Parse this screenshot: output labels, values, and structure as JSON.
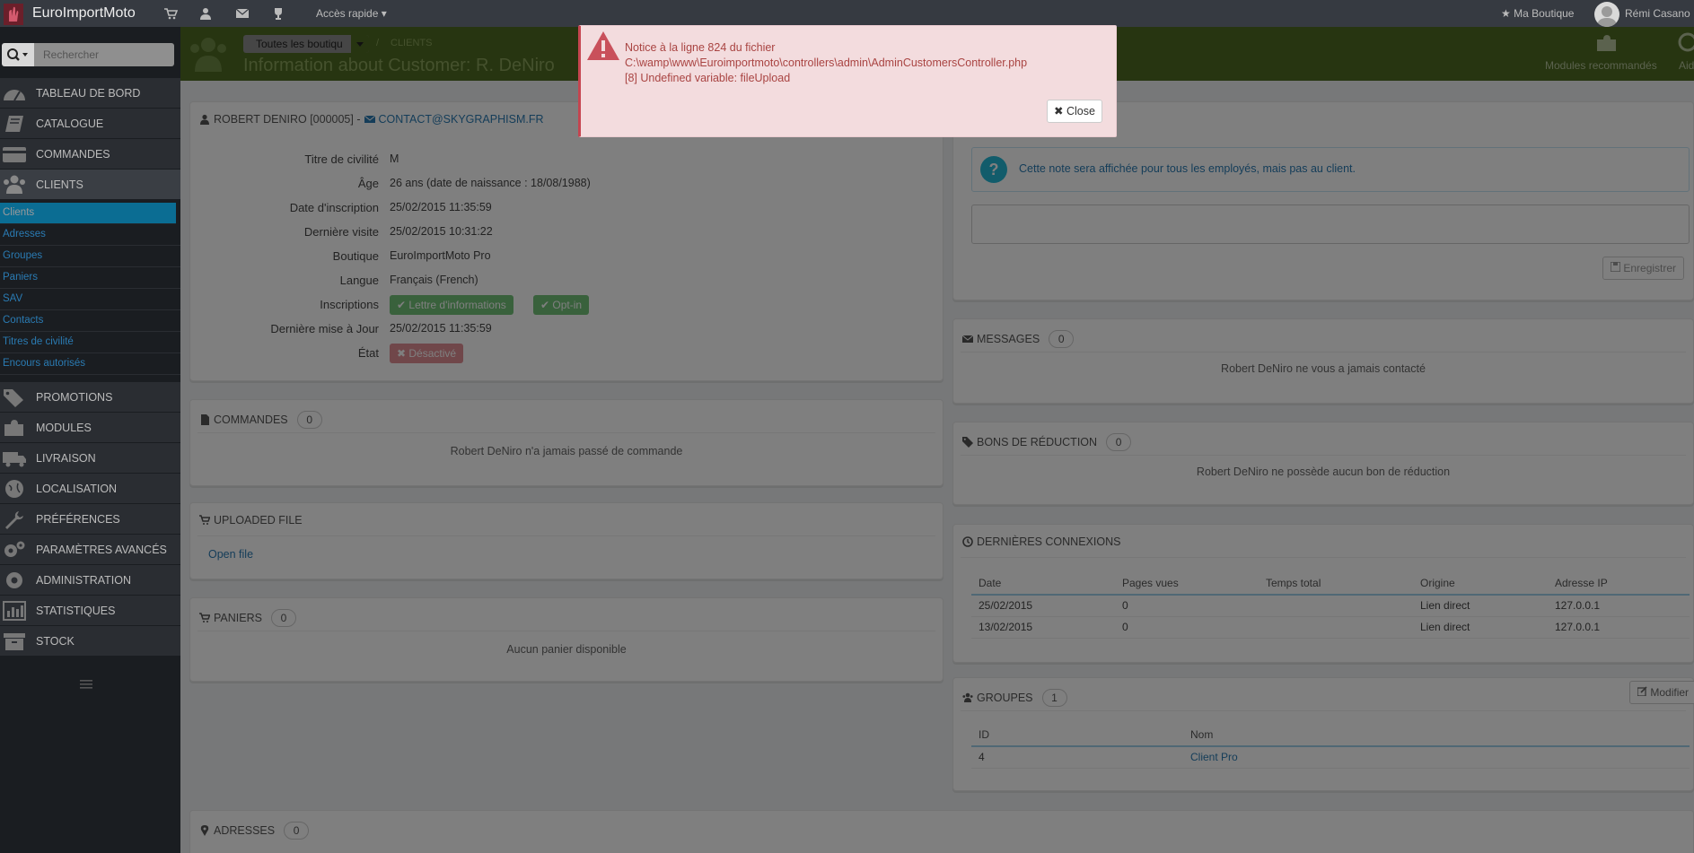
{
  "topbar": {
    "brand": "EuroImportMoto",
    "quick_access": "Accès rapide",
    "my_shop": "Ma Boutique",
    "user_name": "Rémi Casano"
  },
  "sidebar": {
    "search_placeholder": "Rechercher",
    "menu": [
      {
        "label": "TABLEAU DE BORD",
        "icon": "dashboard-icon"
      },
      {
        "label": "CATALOGUE",
        "icon": "book-icon"
      },
      {
        "label": "COMMANDES",
        "icon": "credit-card-icon"
      },
      {
        "label": "CLIENTS",
        "icon": "users-icon"
      },
      {
        "label": "PROMOTIONS",
        "icon": "tags-icon"
      },
      {
        "label": "MODULES",
        "icon": "puzzle-icon"
      },
      {
        "label": "LIVRAISON",
        "icon": "truck-icon"
      },
      {
        "label": "LOCALISATION",
        "icon": "globe-icon"
      },
      {
        "label": "PRÉFÉRENCES",
        "icon": "wrench-icon"
      },
      {
        "label": "PARAMÈTRES AVANCÉS",
        "icon": "cogs-icon"
      },
      {
        "label": "ADMINISTRATION",
        "icon": "cog-icon"
      },
      {
        "label": "STATISTIQUES",
        "icon": "bar-chart-icon"
      },
      {
        "label": "STOCK",
        "icon": "archive-icon"
      }
    ],
    "submenu": [
      "Clients",
      "Adresses",
      "Groupes",
      "Paniers",
      "SAV",
      "Contacts",
      "Titres de civilité",
      "Encours autorisés"
    ]
  },
  "header": {
    "shop_selector": "Toutes les boutiqu",
    "breadcrumb": "CLIENTS",
    "title": "Information about Customer: R. DeNiro",
    "modules_label": "Modules recommandés",
    "help_label": "Aid"
  },
  "alert": {
    "line1": "Notice à la ligne 824 du fichier",
    "line2": "C:\\wamp\\www\\Euroimportmoto\\controllers\\admin\\AdminCustomersController.php",
    "line3": "[8] Undefined variable: fileUpload",
    "close_label": "Close"
  },
  "customer": {
    "heading_name": "ROBERT DENIRO [000005] -",
    "heading_email": "CONTACT@SKYGRAPHISM.FR",
    "fields": [
      {
        "label": "Titre de civilité",
        "value": "M"
      },
      {
        "label": "Âge",
        "value": "26 ans (date de naissance : 18/08/1988)"
      },
      {
        "label": "Date d'inscription",
        "value": "25/02/2015 11:35:59"
      },
      {
        "label": "Dernière visite",
        "value": "25/02/2015 10:31:22"
      },
      {
        "label": "Boutique",
        "value": "EuroImportMoto Pro"
      },
      {
        "label": "Langue",
        "value": "Français (French)"
      },
      {
        "label": "Inscriptions",
        "value": ""
      },
      {
        "label": "Dernière mise à Jour",
        "value": "25/02/2015 11:35:59"
      },
      {
        "label": "État",
        "value": ""
      }
    ],
    "newsletter_tag": "Lettre d'informations",
    "optin_tag": "Opt-in",
    "state_tag": "Désactivé"
  },
  "orders": {
    "title": "COMMANDES",
    "count": "0",
    "empty": "Robert DeNiro n'a jamais passé de commande"
  },
  "uploaded": {
    "title": "UPLOADED FILE",
    "link": "Open file"
  },
  "carts": {
    "title": "PANIERS",
    "count": "0",
    "empty": "Aucun panier disponible"
  },
  "addresses": {
    "title": "ADRESSES",
    "count": "0"
  },
  "note": {
    "info": "Cette note sera affichée pour tous les employés, mais pas au client.",
    "save_label": "Enregistrer"
  },
  "messages": {
    "title": "MESSAGES",
    "count": "0",
    "empty": "Robert DeNiro ne vous a jamais contacté"
  },
  "vouchers": {
    "title": "BONS DE RÉDUCTION",
    "count": "0",
    "empty": "Robert DeNiro ne possède aucun bon de réduction"
  },
  "connections": {
    "title": "DERNIÈRES CONNEXIONS",
    "columns": [
      "Date",
      "Pages vues",
      "Temps total",
      "Origine",
      "Adresse IP"
    ],
    "rows": [
      [
        "25/02/2015",
        "0",
        "",
        "Lien direct",
        "127.0.0.1"
      ],
      [
        "13/02/2015",
        "0",
        "",
        "Lien direct",
        "127.0.0.1"
      ]
    ]
  },
  "groups": {
    "title": "GROUPES",
    "count": "1",
    "edit_label": "Modifier",
    "columns": [
      "ID",
      "Nom"
    ],
    "rows": [
      [
        "4",
        "Client Pro"
      ]
    ]
  }
}
